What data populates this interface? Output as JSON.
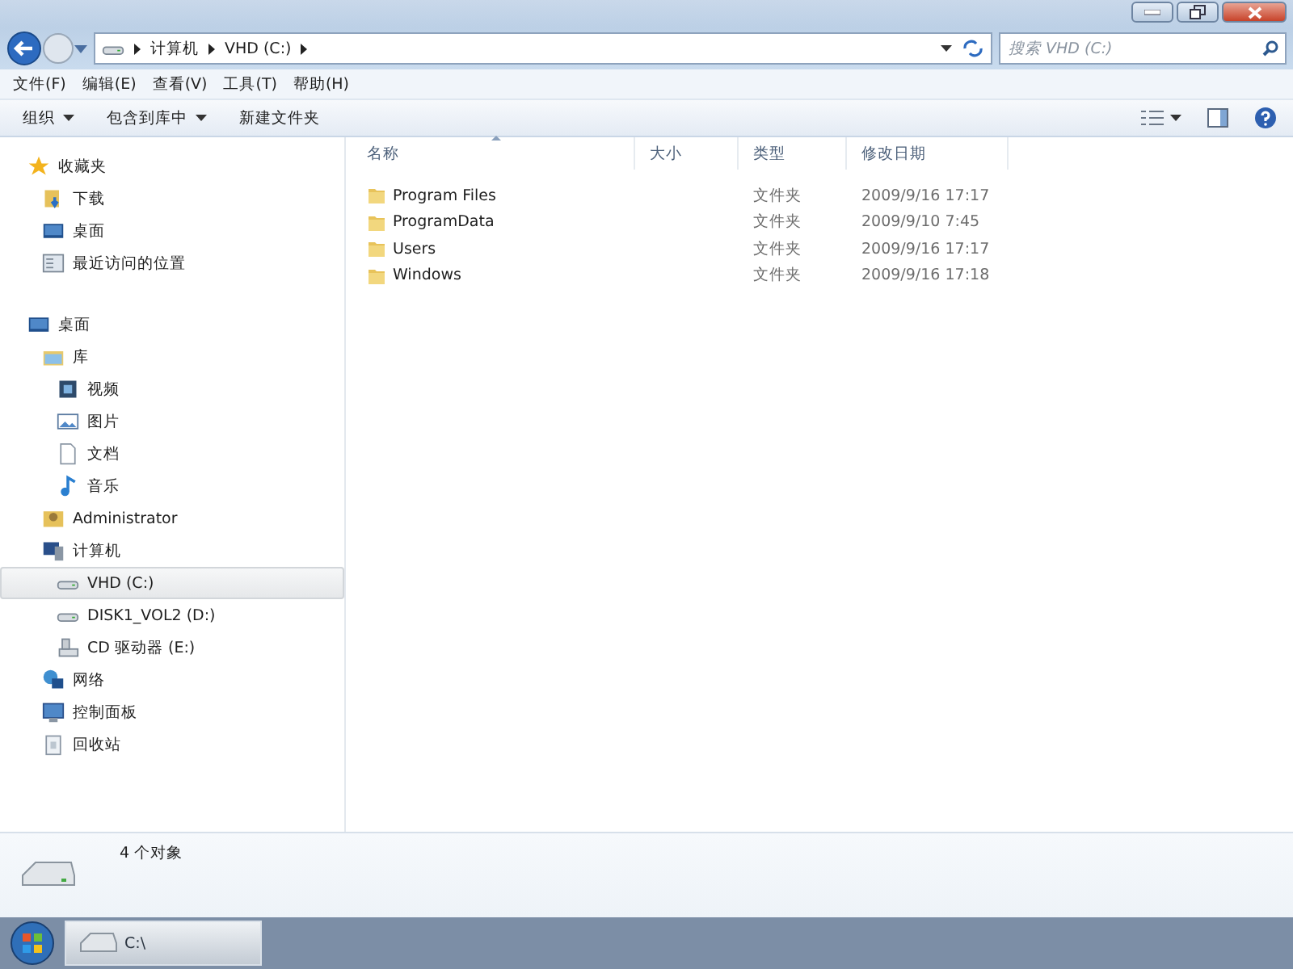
{
  "address_bar": {
    "breadcrumbs": [
      "计算机",
      "VHD (C:)"
    ]
  },
  "search": {
    "placeholder": "搜索 VHD (C:)"
  },
  "menu_bar": [
    "文件(F)",
    "编辑(E)",
    "查看(V)",
    "工具(T)",
    "帮助(H)"
  ],
  "toolbar": [
    {
      "label": "组织",
      "dropdown": true
    },
    {
      "label": "包含到库中",
      "dropdown": true
    },
    {
      "label": "新建文件夹",
      "dropdown": false
    }
  ],
  "sidebar": {
    "groups": [
      {
        "label": "收藏夹",
        "kind": "star",
        "selected": false,
        "children": [
          {
            "label": "下载",
            "kind": "download",
            "selected": false
          },
          {
            "label": "桌面",
            "kind": "desktop",
            "selected": false
          },
          {
            "label": "最近访问的位置",
            "kind": "recent",
            "selected": false
          }
        ]
      },
      {
        "label": "桌面",
        "kind": "desktop",
        "selected": false,
        "children": [
          {
            "label": "库",
            "kind": "library",
            "selected": false,
            "children": [
              {
                "label": "视频",
                "kind": "video",
                "selected": false
              },
              {
                "label": "图片",
                "kind": "picture",
                "selected": false
              },
              {
                "label": "文档",
                "kind": "document",
                "selected": false
              },
              {
                "label": "音乐",
                "kind": "music",
                "selected": false
              }
            ]
          },
          {
            "label": "Administrator",
            "kind": "user",
            "selected": false
          },
          {
            "label": "计算机",
            "kind": "computer",
            "selected": false,
            "children": [
              {
                "label": "VHD (C:)",
                "kind": "drive",
                "selected": true
              },
              {
                "label": "DISK1_VOL2 (D:)",
                "kind": "drive",
                "selected": false
              },
              {
                "label": "CD 驱动器 (E:)",
                "kind": "cd",
                "selected": false
              }
            ]
          },
          {
            "label": "网络",
            "kind": "network",
            "selected": false
          },
          {
            "label": "控制面板",
            "kind": "control",
            "selected": false
          },
          {
            "label": "回收站",
            "kind": "recycle",
            "selected": false
          }
        ]
      }
    ]
  },
  "file_list": {
    "columns": [
      "名称",
      "大小",
      "类型",
      "修改日期"
    ],
    "rows": [
      {
        "name": "Program Files",
        "type": "文件夹",
        "modified": "2009/9/16 17:17"
      },
      {
        "name": "ProgramData",
        "type": "文件夹",
        "modified": "2009/9/10 7:45"
      },
      {
        "name": "Users",
        "type": "文件夹",
        "modified": "2009/9/16 17:17"
      },
      {
        "name": "Windows",
        "type": "文件夹",
        "modified": "2009/9/16 17:18"
      }
    ]
  },
  "details_pane": {
    "summary": "4 个对象"
  },
  "taskbar": {
    "windows": [
      {
        "label": "C:\\",
        "selected": true
      }
    ]
  }
}
